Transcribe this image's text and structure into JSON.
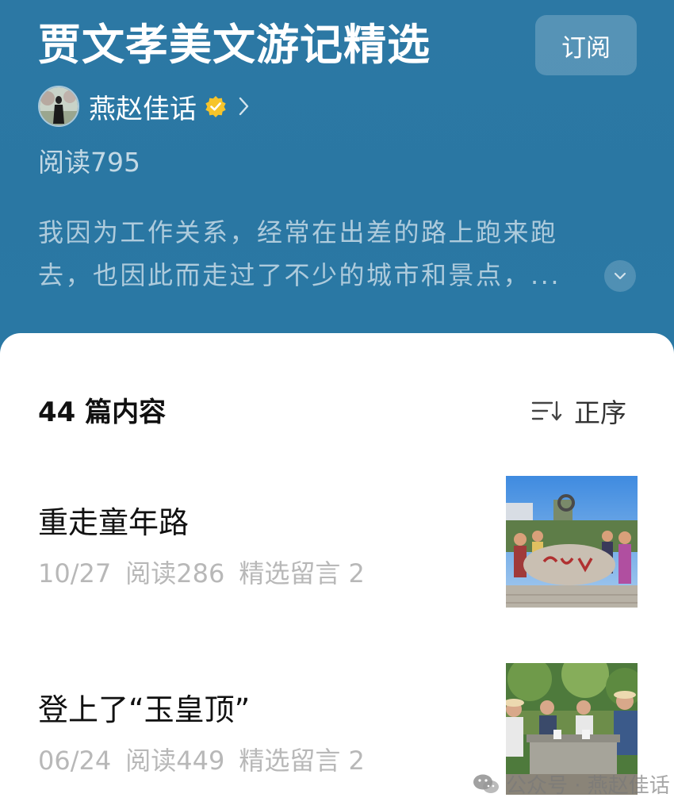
{
  "header": {
    "title": "贾文孝美文游记精选",
    "subscribe_label": "订阅",
    "author": {
      "name": "燕赵佳话"
    },
    "reads": "阅读795",
    "description": {
      "line1": "我因为工作关系，经常在出差的路上跑来跑",
      "line2": "去，也因此而走过了不少的城市和景点，..."
    },
    "icons": {
      "verified": "verified-badge-icon",
      "chevron": "chevron-right-icon",
      "expand": "chevron-down-icon"
    }
  },
  "list": {
    "count": "44 篇内容",
    "sort_label": "正序",
    "sort_icon": "sort-order-icon",
    "articles": [
      {
        "title": "重走童年路",
        "date": "10/27",
        "reads": "阅读286",
        "comments": "精选留言 2"
      },
      {
        "title": "登上了“玉皇顶”",
        "date": "06/24",
        "reads": "阅读449",
        "comments": "精选留言 2"
      }
    ]
  },
  "watermark": {
    "text": "公众号 · 燕赵佳话",
    "icon": "wechat-icon"
  },
  "colors": {
    "header_bg": "#2a77a3",
    "verified": "#f6c42b"
  }
}
